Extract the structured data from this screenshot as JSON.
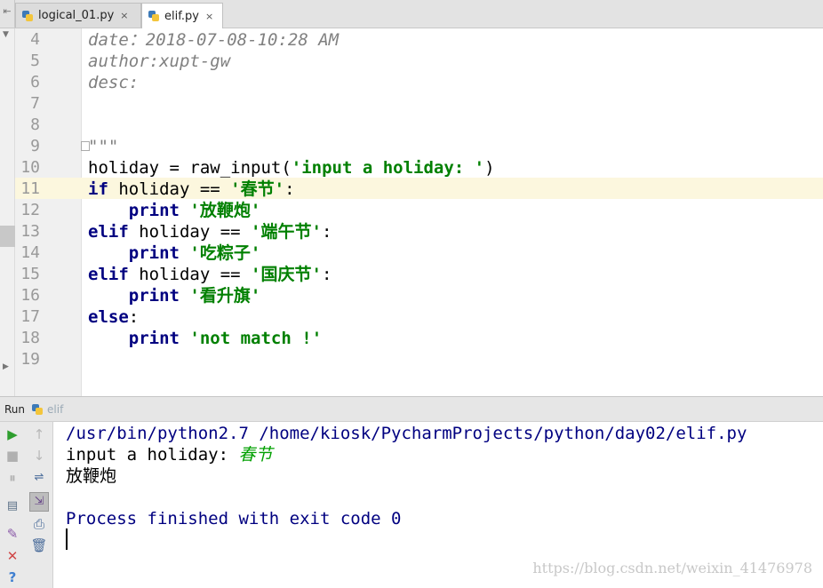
{
  "tabs": [
    {
      "label": "logical_01.py",
      "close": "×",
      "active": false
    },
    {
      "label": "elif.py",
      "close": "×",
      "active": true
    }
  ],
  "editor": {
    "lines": [
      {
        "num": "4",
        "html": "<span class=\"doc\">date：2018-07-08-10:28 AM</span>"
      },
      {
        "num": "5",
        "html": "<span class=\"doc\">author:xupt-gw</span>"
      },
      {
        "num": "6",
        "html": "<span class=\"doc\">desc:</span>"
      },
      {
        "num": "7",
        "html": ""
      },
      {
        "num": "8",
        "html": ""
      },
      {
        "num": "9",
        "html": "<span class=\"doc\">\"\"\"</span>"
      },
      {
        "num": "10",
        "html": "holiday = raw_input(<span class=\"str\">'input a holiday: '</span>)"
      },
      {
        "num": "11",
        "html": "<span class=\"kw\">if</span> holiday == <span class=\"str\">'春节'</span>:"
      },
      {
        "num": "12",
        "html": "    <span class=\"kw\">print</span> <span class=\"str\">'放鞭炮'</span>"
      },
      {
        "num": "13",
        "html": "<span class=\"kw\">elif</span> holiday == <span class=\"str\">'端午节'</span>:"
      },
      {
        "num": "14",
        "html": "    <span class=\"kw\">print</span> <span class=\"str\">'吃粽子'</span>"
      },
      {
        "num": "15",
        "html": "<span class=\"kw\">elif</span> holiday == <span class=\"str\">'国庆节'</span>:"
      },
      {
        "num": "16",
        "html": "    <span class=\"kw\">print</span> <span class=\"str\">'看升旗'</span>"
      },
      {
        "num": "17",
        "html": "<span class=\"kw\">else</span>:"
      },
      {
        "num": "18",
        "html": "    <span class=\"kw\">print</span> <span class=\"str\">'not match !'</span>"
      },
      {
        "num": "19",
        "html": ""
      }
    ]
  },
  "run_panel": {
    "title": "Run",
    "config_name": "elif",
    "console": {
      "command": "/usr/bin/python2.7 /home/kiosk/PycharmProjects/python/day02/elif.py",
      "prompt": "input a holiday: ",
      "user_input": "春节",
      "output": "放鞭炮",
      "exit_message": "Process finished with exit code 0"
    }
  },
  "watermark": "https://blog.csdn.net/weixin_41476978",
  "colors": {
    "keyword": "#000080",
    "string": "#008000",
    "docstring": "#808080",
    "line_number": "#999999",
    "current_line": "#fcf7de",
    "console_system": "#000080",
    "console_input": "#00a000"
  },
  "icons": [
    "python-file-icon",
    "close-icon",
    "run-icon",
    "stop-icon",
    "pause-icon",
    "rerun-icon",
    "pin-icon",
    "exit-icon",
    "help-icon",
    "up-arrow-icon",
    "down-arrow-icon",
    "soft-wrap-icon",
    "scroll-to-end-icon",
    "print-icon",
    "trash-icon"
  ]
}
